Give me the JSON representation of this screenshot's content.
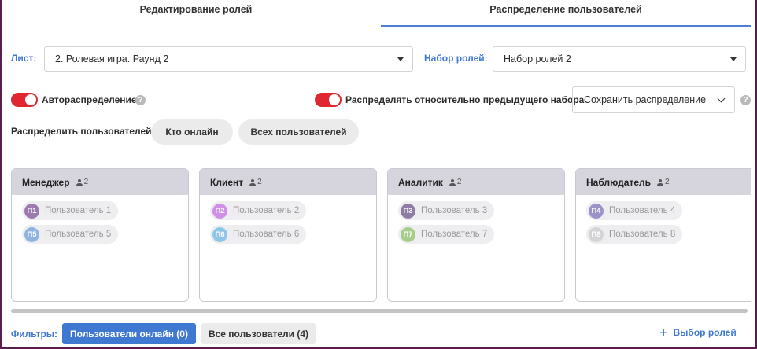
{
  "tabs": [
    {
      "label": "Редактирование ролей",
      "active": false
    },
    {
      "label": "Распределение пользователей",
      "active": true
    }
  ],
  "sheet": {
    "label": "Лист:",
    "value": "2. Ролевая игра. Раунд 2"
  },
  "role_set": {
    "label": "Набор ролей:",
    "value": "Набор ролей 2"
  },
  "auto_distribution": {
    "label": "Автораспределение",
    "enabled": true,
    "help": "?"
  },
  "relative_distribution": {
    "label": "Распределять относительно предыдущего набора",
    "enabled": true
  },
  "save_dropdown": {
    "label": "Сохранить распределение",
    "help": "?"
  },
  "distribute": {
    "label": "Распределить пользователей:",
    "online_button": "Кто онлайн",
    "all_button": "Всех пользователей"
  },
  "roles": [
    {
      "name": "Менеджер",
      "count": "2",
      "users": [
        {
          "initials": "П1",
          "name": "Пользователь 1",
          "color": "#9b7bb0"
        },
        {
          "initials": "П5",
          "name": "Пользователь 5",
          "color": "#8fb4e0"
        }
      ]
    },
    {
      "name": "Клиент",
      "count": "2",
      "users": [
        {
          "initials": "П2",
          "name": "Пользователь 2",
          "color": "#d08ee6"
        },
        {
          "initials": "П6",
          "name": "Пользователь 6",
          "color": "#8ec6ea"
        }
      ]
    },
    {
      "name": "Аналитик",
      "count": "2",
      "users": [
        {
          "initials": "П3",
          "name": "Пользователь 3",
          "color": "#8e7ba6"
        },
        {
          "initials": "П7",
          "name": "Пользователь 7",
          "color": "#a7cc8c"
        }
      ]
    },
    {
      "name": "Наблюдатель",
      "count": "2",
      "users": [
        {
          "initials": "П4",
          "name": "Пользователь 4",
          "color": "#9a92c8"
        },
        {
          "initials": "П8",
          "name": "Пользователь 8",
          "color": "#d4d4d6"
        }
      ]
    }
  ],
  "filters": {
    "label": "Фильтры:",
    "online_button": "Пользователи онлайн (0)",
    "all_button": "Все пользователи (4)"
  },
  "role_picker": {
    "label": "Выбор ролей",
    "icon": "plus-icon"
  },
  "colors": {
    "accent": "#3f78d1",
    "toggle_on": "#e0262e",
    "card_header": "#d6d5de"
  }
}
